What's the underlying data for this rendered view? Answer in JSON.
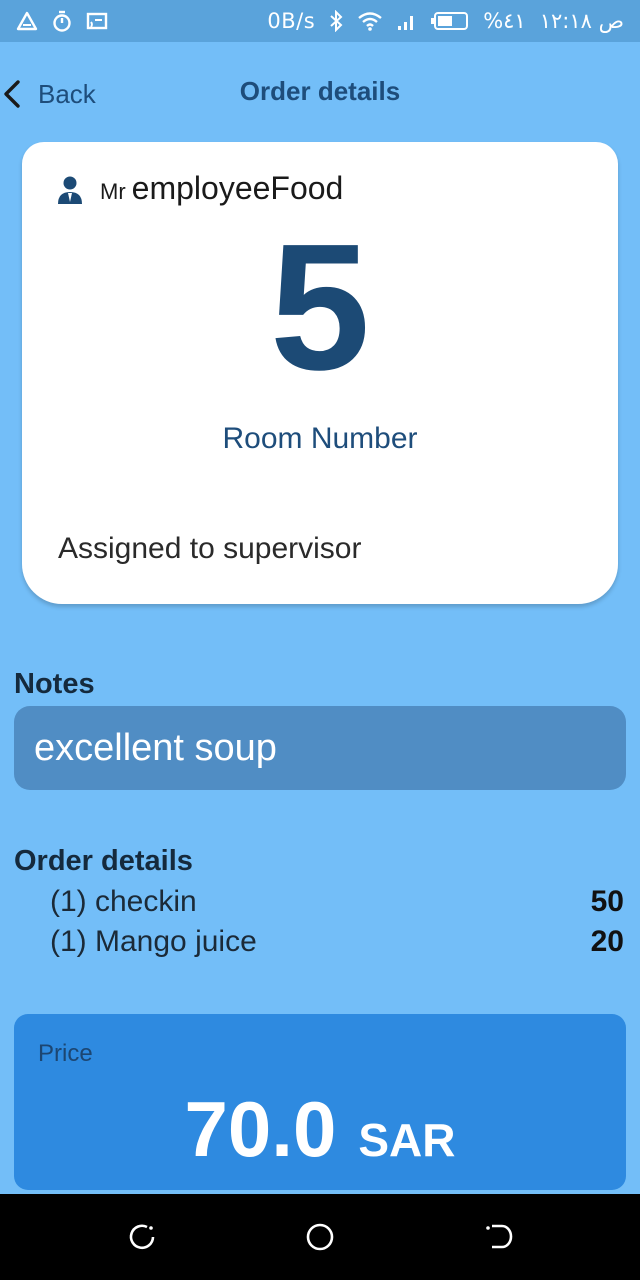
{
  "status_bar": {
    "network_speed": "0B/s",
    "battery_percent": "%٤١",
    "clock": "ص ١٢:١٨",
    "left_icons": [
      "warning-triangle-icon",
      "stopwatch-icon",
      "screencast-icon"
    ],
    "right_icons": [
      "bluetooth-icon",
      "wifi-icon",
      "signal-icon",
      "battery-icon"
    ]
  },
  "app_bar": {
    "back_label": "Back",
    "title": "Order details"
  },
  "card": {
    "employee_title": "Mr",
    "employee_name": "employeeFood",
    "room_number": "5",
    "room_label": "Room Number",
    "assignment_status": "Assigned to supervisor"
  },
  "notes": {
    "heading": "Notes",
    "text": "excellent soup"
  },
  "order": {
    "heading": "Order details",
    "items": [
      {
        "name": "(1) checkin",
        "price": "50"
      },
      {
        "name": "(1) Mango juice",
        "price": "20"
      }
    ]
  },
  "price": {
    "label": "Price",
    "amount": "70.0",
    "currency": "SAR"
  },
  "nav_bar": {
    "buttons": [
      "recent-apps-icon",
      "home-icon",
      "back-nav-icon"
    ]
  },
  "colors": {
    "background": "#73bef8",
    "primary_text": "#1e4d7b",
    "notes_box": "#508dc4",
    "price_box": "#2e8ae0"
  }
}
